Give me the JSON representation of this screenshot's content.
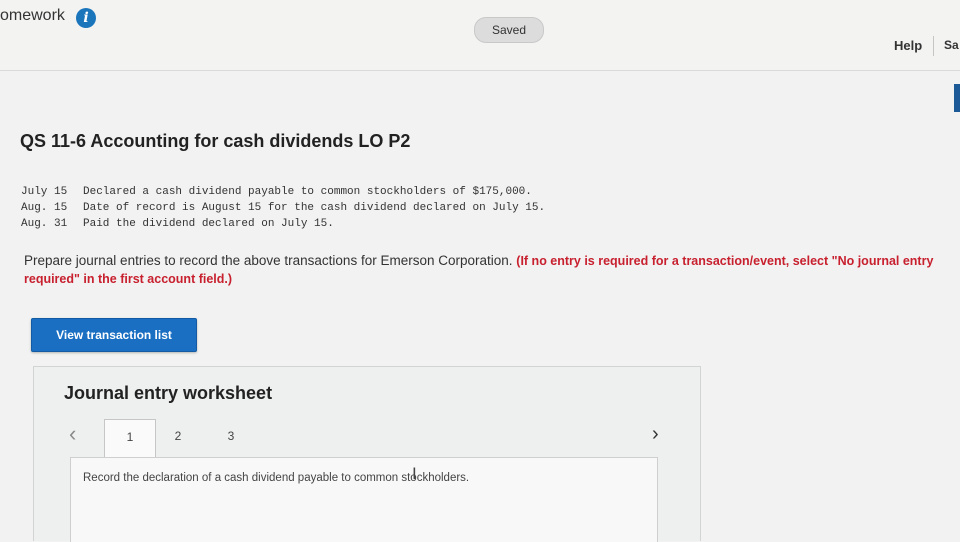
{
  "header": {
    "app_title": "omework",
    "info_icon": "info-icon",
    "status": "Saved",
    "help": "Help",
    "save_partial": "Sa"
  },
  "question": {
    "title": "QS 11-6 Accounting for cash dividends LO P2",
    "transactions": [
      {
        "date": "July 15",
        "text": "Declared a cash dividend payable to common stockholders of $175,000."
      },
      {
        "date": "Aug. 15",
        "text": "Date of record is August 15 for the cash dividend declared on July 15."
      },
      {
        "date": "Aug. 31",
        "text": "Paid the dividend declared on July 15."
      }
    ],
    "instruction": "Prepare journal entries to record the above transactions for Emerson Corporation.",
    "instruction_note": "(If no entry is required for a transaction/event, select \"No journal entry required\" in the first account field.)",
    "note_color": "#c8202f"
  },
  "buttons": {
    "view_transactions": "View transaction list",
    "accent": "#1b6fc2"
  },
  "worksheet": {
    "title": "Journal entry worksheet",
    "prev_icon": "chevron-left-icon",
    "next_icon": "chevron-right-icon",
    "tabs": [
      "1",
      "2",
      "3"
    ],
    "active_tab": "1",
    "description": "Record the declaration of a cash dividend payable to common stockholders."
  }
}
